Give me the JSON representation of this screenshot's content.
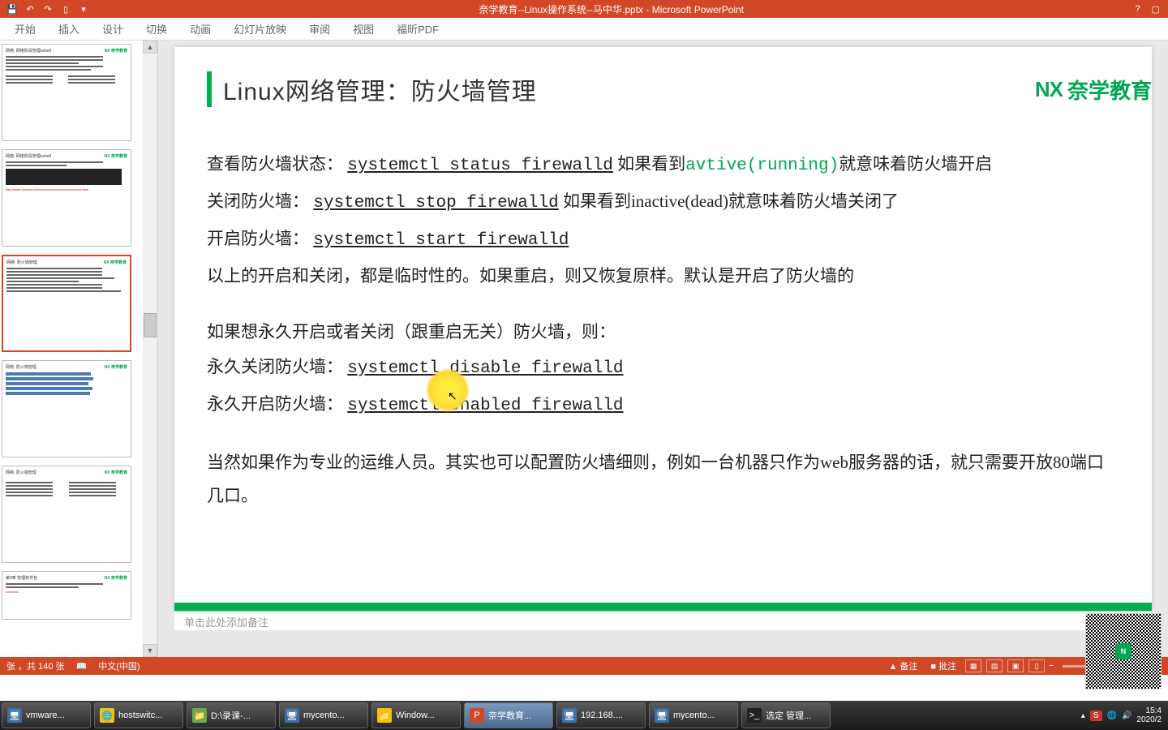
{
  "titlebar": {
    "title": "奈学教育--Linux操作系统--马中华.pptx - Microsoft PowerPoint",
    "help": "?",
    "restore": "▢"
  },
  "ribbon": {
    "tabs": [
      "开始",
      "插入",
      "设计",
      "切换",
      "动画",
      "幻灯片放映",
      "审阅",
      "视图",
      "福昕PDF"
    ]
  },
  "thumbs": {
    "brand": "NX 奈学教育",
    "items": [
      {
        "title": "网络: 网络阶段管理eshell"
      },
      {
        "title": "网络: 网络阶段管理eshell"
      },
      {
        "title": "网络: 防火墙管理",
        "selected": true
      },
      {
        "title": "网络: 防火墙管理"
      },
      {
        "title": "网络: 防火墙管理"
      },
      {
        "title": "第9章 管理软件包"
      }
    ]
  },
  "slide": {
    "title": "Linux网络管理：防火墙管理",
    "brand_nx": "NX",
    "brand_text": "奈学教育",
    "lines": {
      "l1_a": "查看防火墙状态：",
      "l1_cmd": "systemctl status firewalld",
      "l1_b": "  如果看到",
      "l1_green": "avtive(running)",
      "l1_c": "就意味着防火墙开启",
      "l2_a": "关闭防火墙： ",
      "l2_cmd": "systemctl stop firewalld",
      "l2_b": " 如果看到inactive(dead)就意味着防火墙关闭了",
      "l3_a": "开启防火墙： ",
      "l3_cmd": "systemctl start firewalld",
      "l4": "以上的开启和关闭，都是临时性的。如果重启，则又恢复原样。默认是开启了防火墙的",
      "l5": "如果想永久开启或者关闭（跟重启无关）防火墙，则：",
      "l6_a": "永久关闭防火墙： ",
      "l6_cmd": "systemctl disable firewalld",
      "l7_a": "永久开启防火墙： ",
      "l7_cmd": "systemctl enabled firewalld",
      "l8": "当然如果作为专业的运维人员。其实也可以配置防火墙细则，例如一台机器只作为web服务器的话，就只需要开放80端口几口。"
    }
  },
  "notes": {
    "placeholder": "单击此处添加备注"
  },
  "statusbar": {
    "slide_info": "张 ，共 140 张",
    "lang": "中文(中国)",
    "notes_btn": "▲ 备注",
    "comments_btn": "■ 批注"
  },
  "taskbar": {
    "items": [
      {
        "icon": "🖥",
        "label": "vmware...",
        "color": "#3a6ea5"
      },
      {
        "icon": "🌐",
        "label": "hostswitc...",
        "color": "#f4c20d"
      },
      {
        "icon": "📁",
        "label": "D:\\录课-...",
        "color": "#6aa84f"
      },
      {
        "icon": "🖥",
        "label": "mycento...",
        "color": "#3a6ea5"
      },
      {
        "icon": "📁",
        "label": "Window...",
        "color": "#f4c20d"
      },
      {
        "icon": "P",
        "label": "奈学教育...",
        "color": "#d24726",
        "active": true
      },
      {
        "icon": "🖥",
        "label": "192.168....",
        "color": "#3a6ea5"
      },
      {
        "icon": "🖥",
        "label": "mycento...",
        "color": "#3a6ea5"
      },
      {
        "icon": ">_",
        "label": "选定 管理...",
        "color": "#222"
      }
    ],
    "tray_ime": "S",
    "tray_time": "15:4",
    "tray_date": "2020/2"
  }
}
